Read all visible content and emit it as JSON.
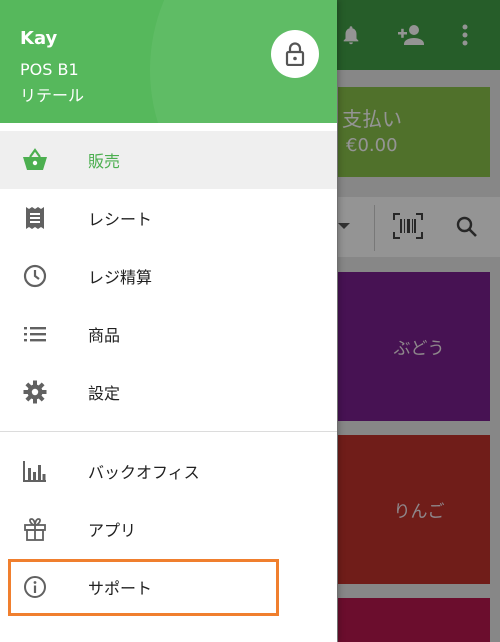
{
  "background": {
    "payment": {
      "label": "支払い",
      "amount": "€0.00"
    },
    "tiles": [
      {
        "label": "ぶどう",
        "color": "#7b1f8f"
      },
      {
        "label": "りんご",
        "color": "#c2322b"
      },
      {
        "label": "",
        "color": "#b8184e"
      }
    ],
    "icons": [
      "bell-icon",
      "add-person-icon",
      "more-vert-icon",
      "barcode-icon",
      "search-icon",
      "dropdown-arrow-icon"
    ]
  },
  "drawer": {
    "user": "Kay",
    "store": "POS B1",
    "role": "リテール",
    "lock_icon": "lock-icon",
    "items": [
      {
        "label": "販売",
        "icon": "basket-icon",
        "active": true
      },
      {
        "label": "レシート",
        "icon": "receipt-icon",
        "active": false
      },
      {
        "label": "レジ精算",
        "icon": "clock-icon",
        "active": false
      },
      {
        "label": "商品",
        "icon": "list-icon",
        "active": false
      },
      {
        "label": "設定",
        "icon": "gear-icon",
        "active": false
      },
      {
        "label": "バックオフィス",
        "icon": "bar-chart-icon",
        "active": false
      },
      {
        "label": "アプリ",
        "icon": "gift-icon",
        "active": false
      },
      {
        "label": "サポート",
        "icon": "info-icon",
        "active": false
      }
    ]
  },
  "colors": {
    "header": "#56b85c",
    "accent": "#4caf50",
    "highlight_border": "#f07f2e"
  }
}
